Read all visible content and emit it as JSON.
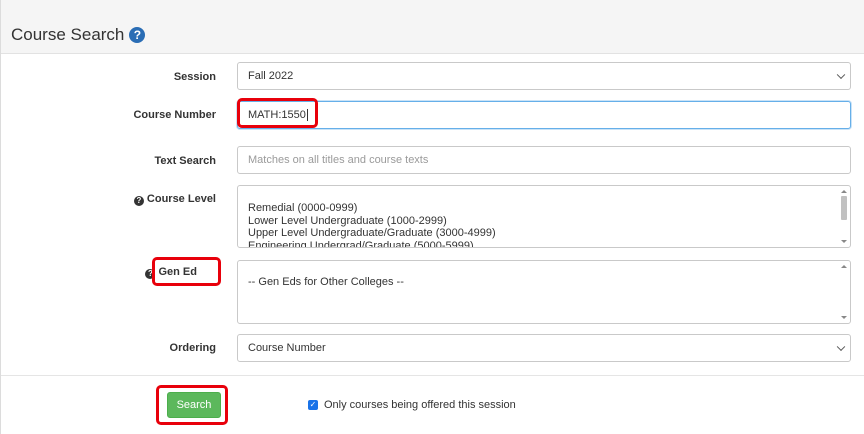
{
  "header": {
    "title": "Course Search",
    "help_icon": "question-circle-icon",
    "help_glyph": "?"
  },
  "form": {
    "session": {
      "label": "Session",
      "value": "Fall 2022"
    },
    "course_number": {
      "label": "Course Number",
      "value": "MATH:1550"
    },
    "text_search": {
      "label": "Text Search",
      "placeholder": "Matches on all titles and course texts"
    },
    "course_level": {
      "label": "Course Level",
      "options": [
        "Remedial (0000-0999)",
        "Lower Level Undergraduate (1000-2999)",
        "Upper Level Undergraduate/Graduate (3000-4999)",
        "Engineering Undergrad/Graduate (5000-5999)"
      ]
    },
    "gen_ed": {
      "label": "Gen Ed",
      "options": [
        "-- Gen Eds for Other Colleges --"
      ]
    },
    "ordering": {
      "label": "Ordering",
      "value": "Course Number"
    }
  },
  "actions": {
    "search_label": "Search",
    "only_offered_label": "Only courses being offered this session",
    "only_offered_checked": true,
    "check_glyph": "✓"
  },
  "colors": {
    "highlight": "#e8000b",
    "search_button": "#5cb85c",
    "help_icon": "#2a6db5",
    "checkbox": "#1a73e8"
  }
}
